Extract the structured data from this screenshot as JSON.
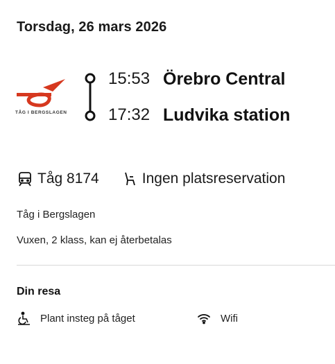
{
  "date": "Torsdag, 26 mars 2026",
  "operator_logo": {
    "text": "Tåg i Bergslagen",
    "color": "#d6381f"
  },
  "journey": {
    "departure": {
      "time": "15:53",
      "station": "Örebro Central"
    },
    "arrival": {
      "time": "17:32",
      "station": "Ludvika station"
    }
  },
  "train": {
    "icon": "train-icon",
    "label": "Tåg 8174"
  },
  "seat": {
    "icon": "seat-icon",
    "label": "Ingen platsreservation"
  },
  "operator_name": "Tåg i Bergslagen",
  "ticket_type": "Vuxen, 2 klass, kan ej återbetalas",
  "trip_section": {
    "title": "Din resa",
    "features": [
      {
        "icon": "wheelchair-icon",
        "label": "Plant insteg på tåget"
      },
      {
        "icon": "wifi-icon",
        "label": "Wifi"
      }
    ]
  }
}
